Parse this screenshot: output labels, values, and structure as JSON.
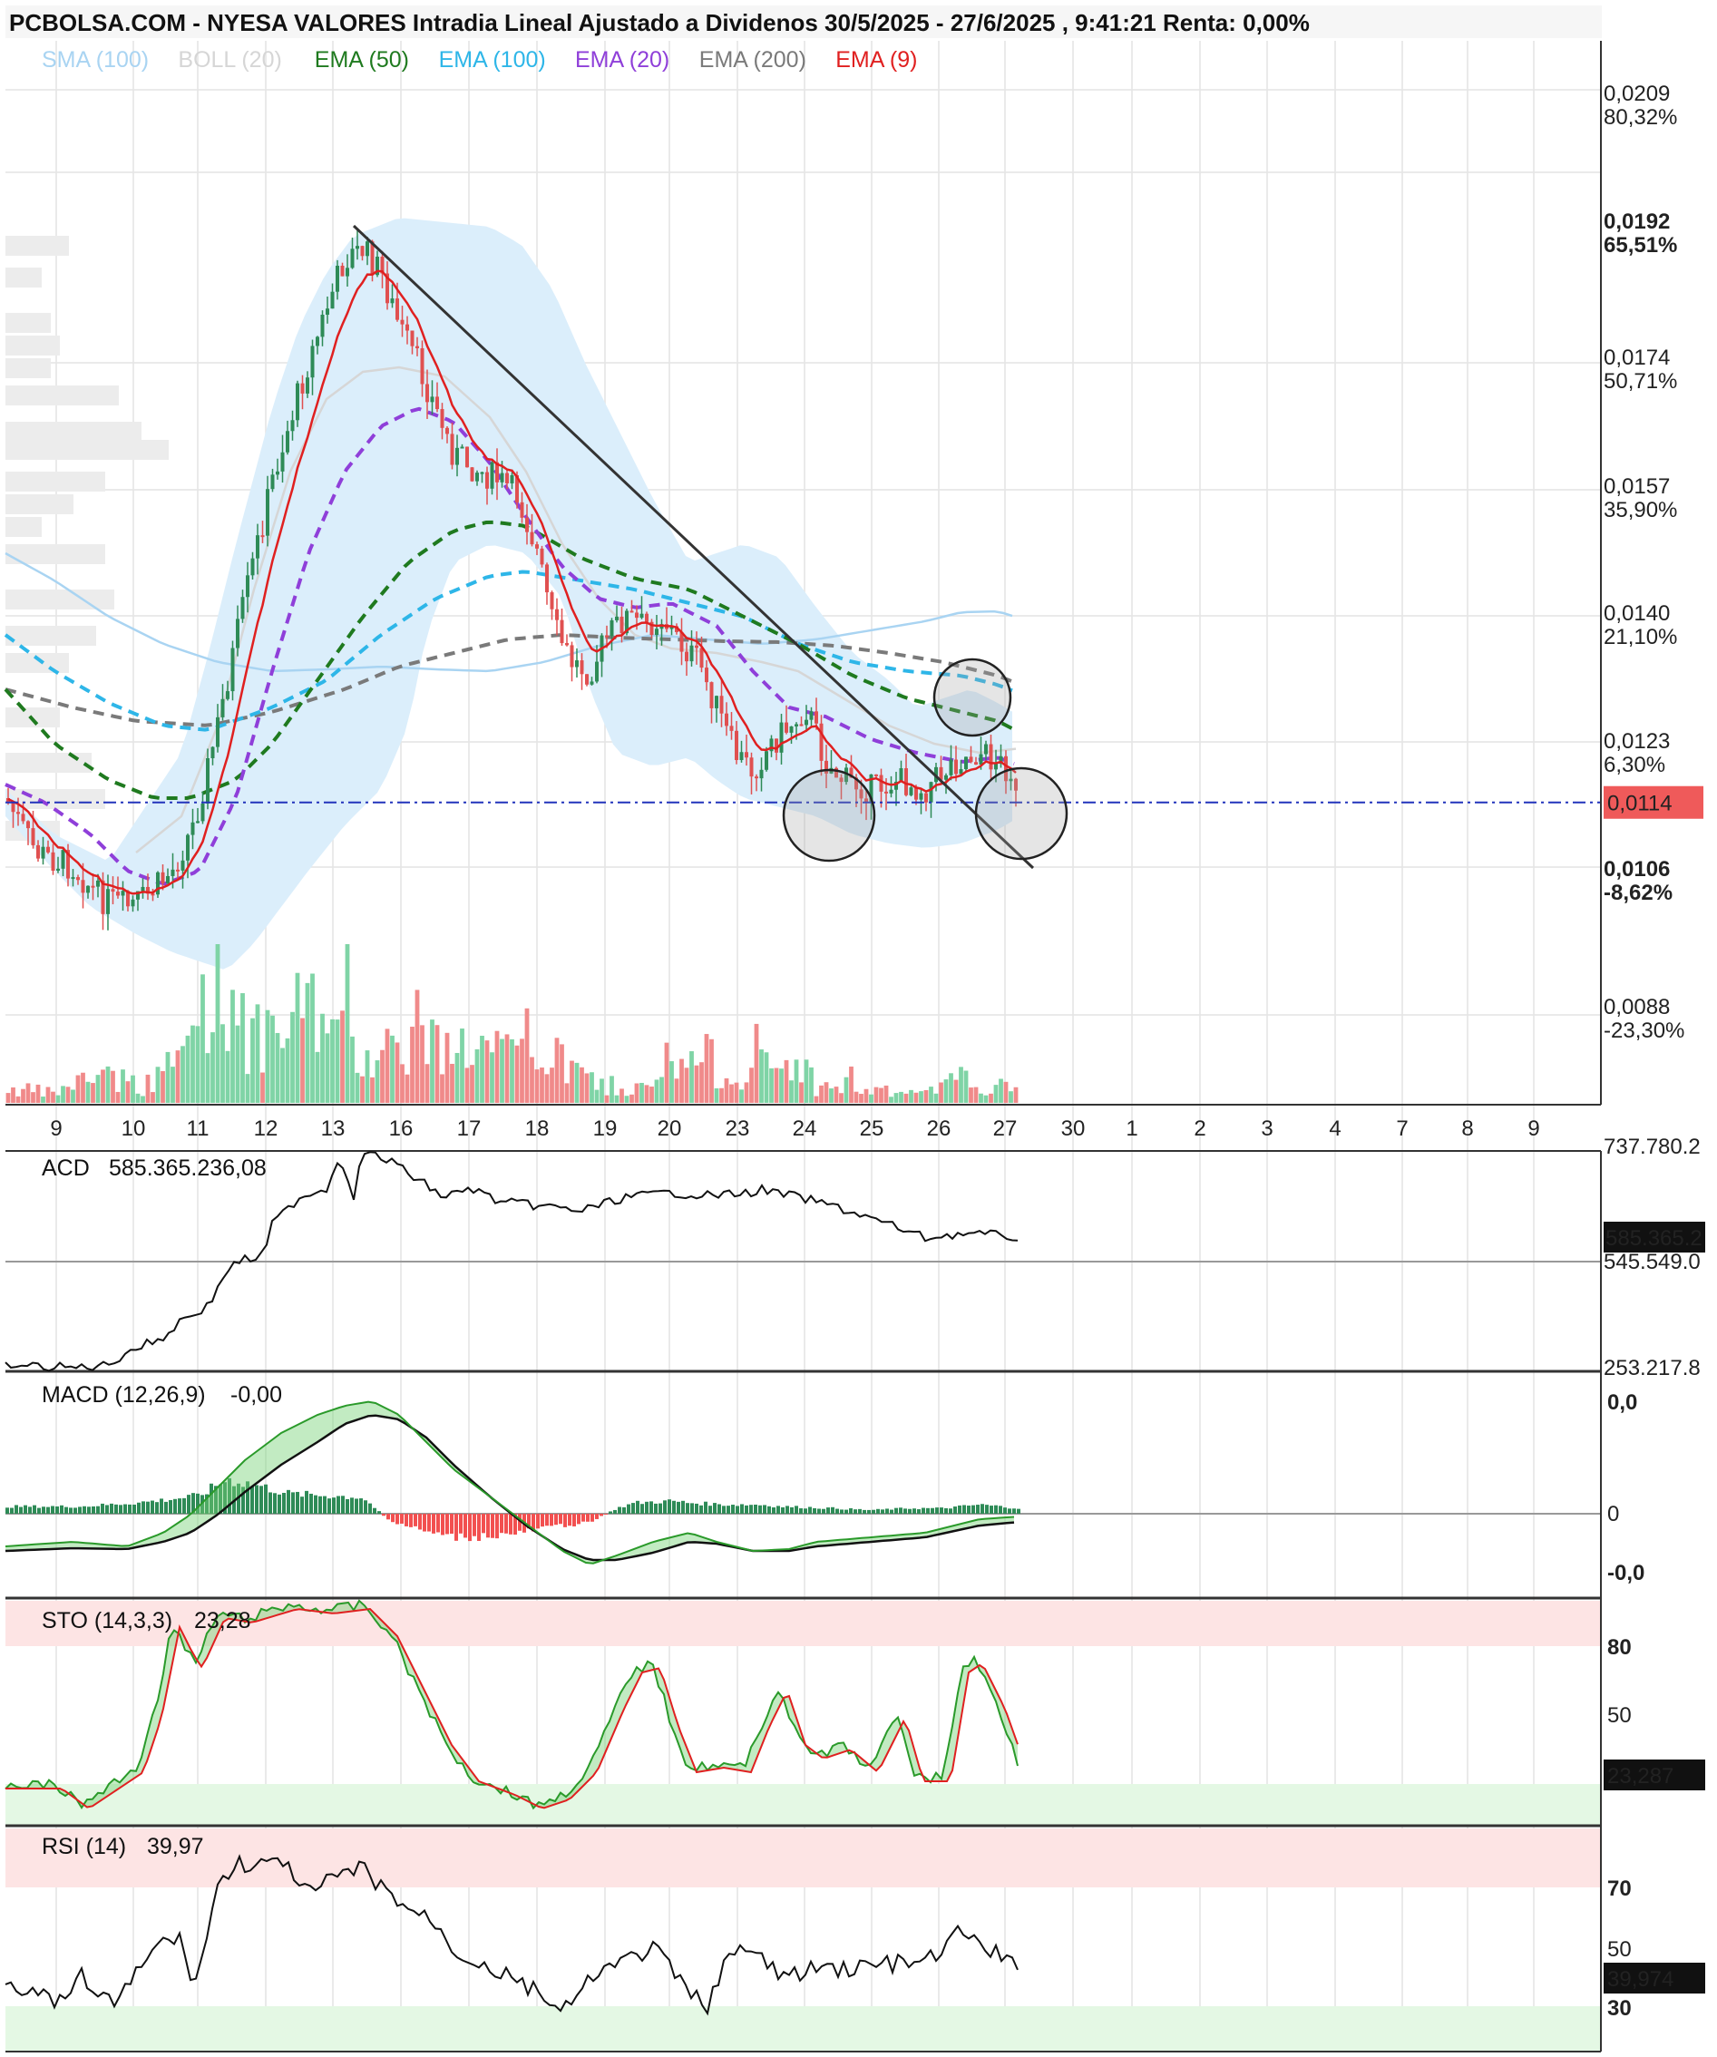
{
  "header": "PCBOLSA.COM - NYESA VALORES Intradia Lineal Ajustado a Dividenos 30/5/2025 - 27/6/2025 , 9:41:21 Renta: 0,00%",
  "legend": [
    {
      "text": "SMA (100)",
      "color": "#a9d4f2"
    },
    {
      "text": "BOLL (20)",
      "color": "#d6d6d6"
    },
    {
      "text": "EMA (50)",
      "color": "#1f7a1f"
    },
    {
      "text": "EMA (100)",
      "color": "#2eb6e8"
    },
    {
      "text": "EMA (20)",
      "color": "#8f3fd9"
    },
    {
      "text": "EMA (200)",
      "color": "#7a7a7a"
    },
    {
      "text": "EMA (9)",
      "color": "#e02020"
    }
  ],
  "colors": {
    "up": "#2e8b57",
    "down": "#e05050",
    "vol_up": "#7fd4a6",
    "vol_down": "#f08a8a",
    "band": "#dbeefb",
    "grid": "#e4e4e4",
    "level": "#2233bb"
  },
  "price_axis": [
    {
      "price": "0,0209",
      "pct": "80,32%",
      "pct_color": "#3a9a6a",
      "bold": false
    },
    {
      "price": "0,0192",
      "pct": "65,51%",
      "pct_color": "#3a9a6a",
      "bold": true
    },
    {
      "price": "0,0174",
      "pct": "50,71%",
      "pct_color": "#3a9a6a",
      "bold": false
    },
    {
      "price": "0,0157",
      "pct": "35,90%",
      "pct_color": "#3a9a6a",
      "bold": false
    },
    {
      "price": "0,0140",
      "pct": "21,10%",
      "pct_color": "#3a9a6a",
      "bold": false
    },
    {
      "price": "0,0123",
      "pct": "6,30%",
      "pct_color": "#3a9a6a",
      "bold": false
    },
    {
      "price": "0,0106",
      "pct": "-8,62%",
      "pct_color": "#e04040",
      "bold": true
    },
    {
      "price": "0,0088",
      "pct": "-23,30%",
      "pct_color": "#e04040",
      "bold": false
    }
  ],
  "last_price": "0,0114",
  "dates": [
    "9",
    "10",
    "11",
    "12",
    "13",
    "16",
    "17",
    "18",
    "19",
    "20",
    "23",
    "24",
    "25",
    "26",
    "27",
    "30",
    "1",
    "2",
    "3",
    "4",
    "7",
    "8",
    "9"
  ],
  "chart_data": {
    "type": "candlestick",
    "title": "NYESA VALORES Intradia Lineal Ajustado a Dividenos 30/5/2025 - 27/6/2025",
    "x_dates": [
      "9",
      "10",
      "11",
      "12",
      "13",
      "16",
      "17",
      "18",
      "19",
      "20",
      "23",
      "24",
      "25",
      "26",
      "27"
    ],
    "y_range": [
      0.0082,
      0.0215
    ],
    "last": 0.0114,
    "daily_close_approx": [
      0.0112,
      0.0104,
      0.0121,
      0.0158,
      0.0188,
      0.0168,
      0.0151,
      0.0131,
      0.0138,
      0.0131,
      0.0122,
      0.0118,
      0.0119,
      0.0124,
      0.0114
    ],
    "trendline": {
      "from": {
        "date": "13",
        "price": 0.0192
      },
      "to": {
        "date": "27",
        "price": 0.0109
      }
    },
    "indicators": [
      {
        "name": "ACD",
        "value": "585.365.236,08",
        "axis": [
          "737.780.2",
          "585.365.2",
          "545.549.0",
          "253.217.8"
        ]
      },
      {
        "name": "MACD (12,26,9)",
        "value": "-0,00",
        "axis": [
          "0,0",
          "0",
          "-0,0"
        ]
      },
      {
        "name": "STO (14,3,3)",
        "value": "23,28",
        "axis": [
          "80",
          "50",
          "23,287"
        ]
      },
      {
        "name": "RSI (14)",
        "value": "39,97",
        "axis": [
          "70",
          "50",
          "39,974",
          "30"
        ]
      }
    ]
  },
  "panels": {
    "acd": {
      "label": "ACD",
      "value": "585.365.236,08",
      "ticks": [
        "737.780.2",
        "545.549.0",
        "253.217.8"
      ],
      "current": "585.365.2"
    },
    "macd": {
      "label": "MACD (12,26,9)",
      "value": "-0,00",
      "top": "0,0",
      "zero": "0",
      "bottom": "-0,0"
    },
    "sto": {
      "label": "STO (14,3,3)",
      "value": "23,28",
      "t80": "80",
      "t50": "50",
      "current": "23,287"
    },
    "rsi": {
      "label": "RSI (14)",
      "value": "39,97",
      "t70": "70",
      "t50": "50",
      "t30": "30",
      "current": "39,974"
    }
  }
}
